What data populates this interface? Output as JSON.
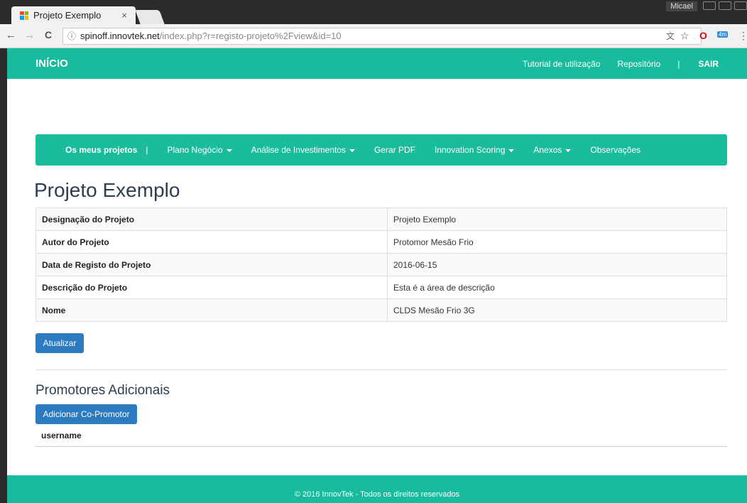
{
  "browser": {
    "tab_title": "Projeto Exemplo",
    "tab_close": "×",
    "user_name": "Micael",
    "url_host": "spinoff.innovtek.net",
    "url_path": "/index.php?r=registo-projeto%2Fview&id=10",
    "icons": {
      "back": "←",
      "forward": "→",
      "reload": "C",
      "info": "ⓘ",
      "translate": "文",
      "bookmark": "☆",
      "opera": "O",
      "extension_badge": "4m",
      "menu": "⋮"
    }
  },
  "top_nav": {
    "brand": "INÍCIO",
    "tutorial": "Tutorial de utilização",
    "repository": "Repositório",
    "separator": "|",
    "logout": "SAIR"
  },
  "sub_nav": {
    "my_projects": "Os meus projetos",
    "separator": "|",
    "business_plan": "Plano Negócio",
    "investment_analysis": "Análise de Investimentos",
    "generate_pdf": "Gerar PDF",
    "innovation_scoring": "Innovation Scoring",
    "attachments": "Anexos",
    "observations": "Observações"
  },
  "page_title": "Projeto Exemplo",
  "details": [
    {
      "label": "Designação do Projeto",
      "value": "Projeto Exemplo"
    },
    {
      "label": "Autor do Projeto",
      "value": "Protomor Mesão Frio"
    },
    {
      "label": "Data de Registo do Projeto",
      "value": "2016-06-15"
    },
    {
      "label": "Descrição do Projeto",
      "value": "Esta é a área de descrição"
    },
    {
      "label": "Nome",
      "value": "CLDS Mesão Frio 3G"
    }
  ],
  "update_button": "Atualizar",
  "promoters": {
    "heading": "Promotores Adicionais",
    "add_button": "Adicionar Co-Promotor",
    "column_username": "username"
  },
  "footer": "© 2016 InnovTek - Todos os direitos reservados",
  "colors": {
    "brand_green": "#18bc9c",
    "button_blue": "#2c7bc0"
  }
}
